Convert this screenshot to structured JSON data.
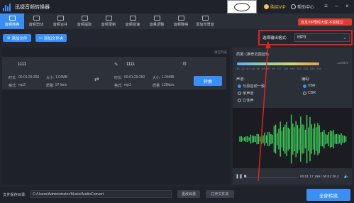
{
  "app": {
    "title": "迅捷音频转换器",
    "vip_label": "购买VIP",
    "help_label": "帮助中心"
  },
  "tabs": [
    {
      "label": "音频转换"
    },
    {
      "label": "音频剪切"
    },
    {
      "label": "音频合并"
    },
    {
      "label": "音频提取"
    },
    {
      "label": "音频录制"
    },
    {
      "label": "音频变速"
    },
    {
      "label": "音量调整"
    },
    {
      "label": "音频降噪"
    },
    {
      "label": "添加背景音"
    }
  ],
  "promo": "双旦VIP限时大促,不容错过",
  "toolbar": {
    "add_file": "添加文件",
    "add_folder": "添加文件夹",
    "format_label": "选择输出格式:",
    "format_value": "MP3"
  },
  "file_list": {
    "clear_label": "清空列表",
    "source": {
      "name": "1111",
      "duration_label": "时长:",
      "duration": "00:01:29:260",
      "size_label": "大小:",
      "size": "1.04MB",
      "format_label": "格式:",
      "format": "mp3",
      "quality_label": "质量:",
      "quality": "97 kb/s"
    },
    "target": {
      "name": "1111",
      "duration_label": "时长:",
      "duration": "00:01:29:260",
      "size_label": "大小:",
      "size": "1.04MB",
      "format_label": "格式:",
      "format": "mp3",
      "quality_label": "质量:",
      "quality": "128kb/s"
    },
    "convert_label": "转换"
  },
  "settings": {
    "quality_label": "质量: (推荐范围蓝色",
    "quality_ticks": [
      "16",
      "32",
      "40",
      "48",
      "56",
      "64",
      "80",
      "96",
      "112",
      "128",
      "160",
      "192",
      "224",
      "256",
      "320"
    ],
    "quality_value": "128kb/s",
    "channel_label": "声道:",
    "channel_options": [
      "与原音频一致",
      "单声道",
      "立体声"
    ],
    "encode_label": "编码:",
    "encode_options": [
      "VBR",
      "CBR"
    ]
  },
  "player": {
    "time": "00:01:17.199 / 00:01:29.2"
  },
  "footer": {
    "output_dir_label": "文件保存目录:",
    "output_dir": "C:/Users/Administrator/Music/AudioConvert",
    "change_dir_label": "更改目录",
    "open_folder_label": "打开文件夹",
    "convert_all_label": "全部转换"
  }
}
